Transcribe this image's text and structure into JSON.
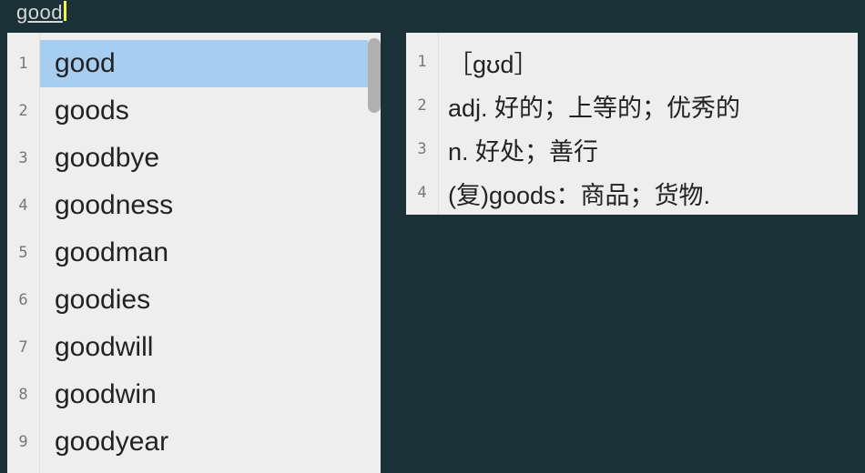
{
  "search": {
    "query": "good"
  },
  "suggestions": [
    "good",
    "goods",
    "goodbye",
    "goodness",
    "goodman",
    "goodies",
    "goodwill",
    "goodwin",
    "goodyear"
  ],
  "selected_index": 0,
  "definition_lines": [
    "［ɡʊd］",
    "adj. 好的；上等的；优秀的",
    "n. 好处；善行",
    "(复)goods：商品；货物."
  ]
}
